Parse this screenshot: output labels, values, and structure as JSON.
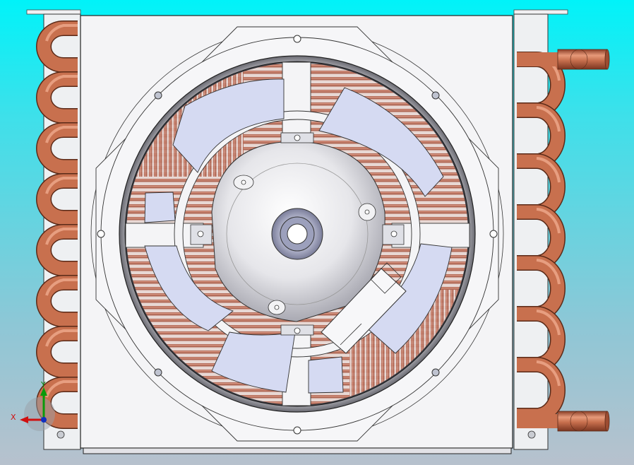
{
  "viewport": {
    "background_top": "#00f3f9",
    "background_bottom": "#b7c1cd"
  },
  "model": {
    "description_icon": "fan-condenser-coil-3d-model",
    "tube_color": "#c8704e",
    "panel_color": "#f4f4f6",
    "blade_color": "#d5daf2",
    "fin_color": "#a86350"
  },
  "triad": {
    "x_label": "X",
    "y_label": "Y",
    "x_color": "#d01010",
    "y_color": "#0a8a0a",
    "z_color": "#1030c0"
  }
}
